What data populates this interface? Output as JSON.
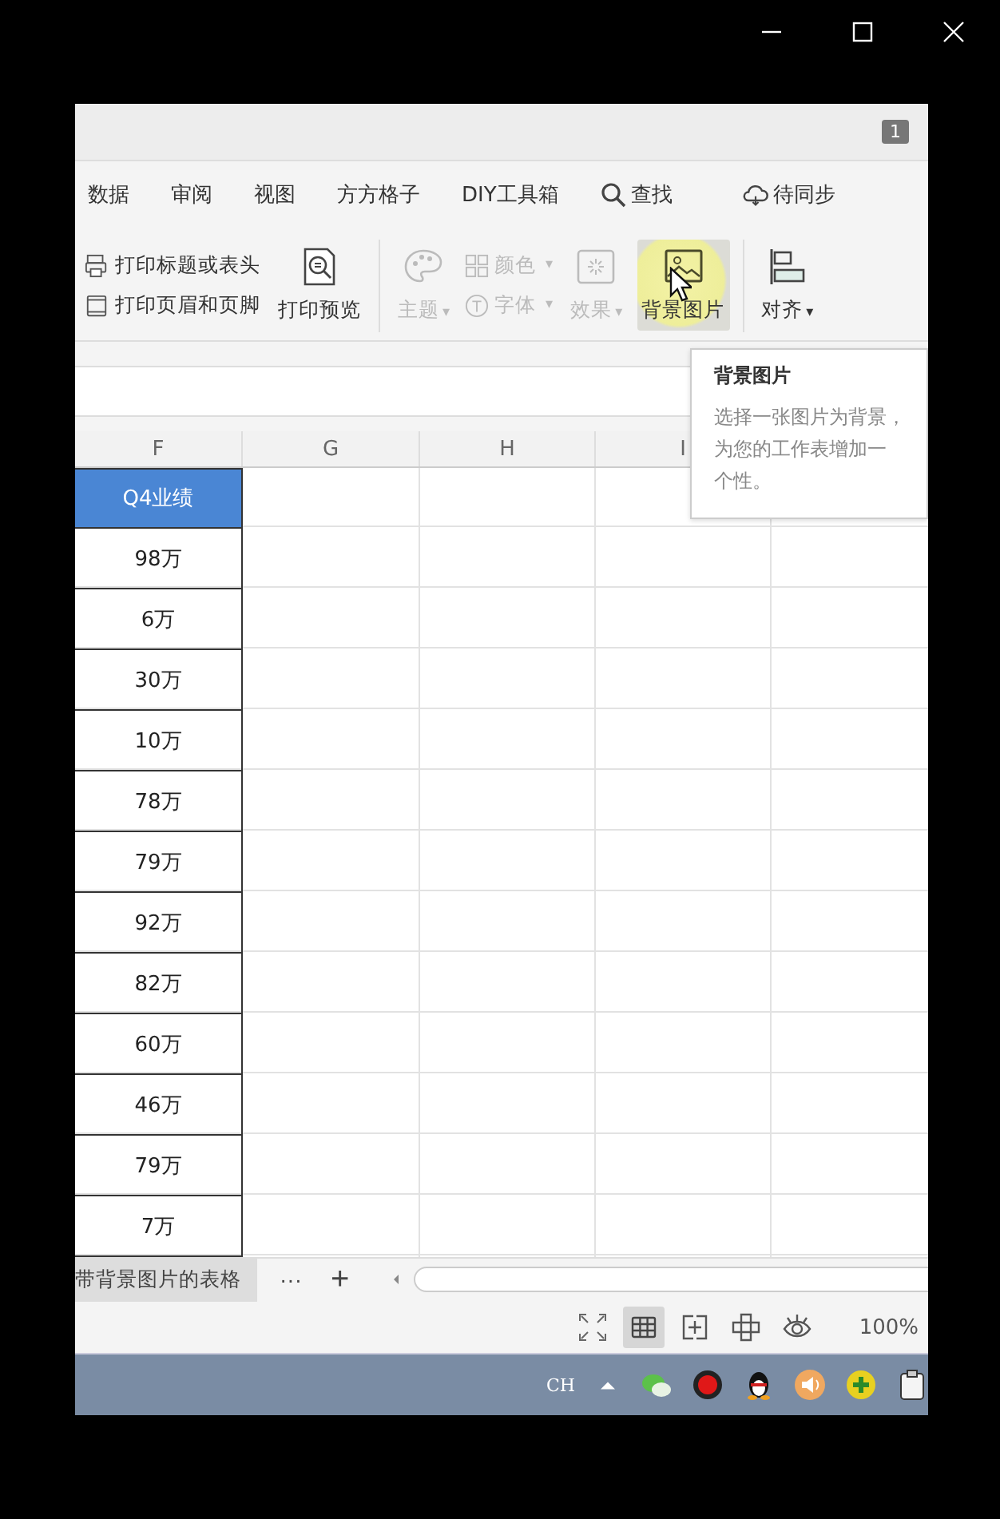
{
  "window_controls": [
    {
      "kind": "minimize"
    },
    {
      "kind": "maximize"
    },
    {
      "kind": "close"
    }
  ],
  "top_badge": "1",
  "menu": [
    {
      "label": "数据",
      "kind": "text"
    },
    {
      "label": "审阅",
      "kind": "text"
    },
    {
      "label": "视图",
      "kind": "text"
    },
    {
      "label": "方方格子",
      "kind": "text"
    },
    {
      "label": "DIY工具箱",
      "kind": "text"
    },
    {
      "label": "查找",
      "kind": "search"
    },
    {
      "label": "待同步",
      "kind": "sync"
    }
  ],
  "ribbon": {
    "print_small": [
      {
        "label": "打印标题或表头"
      },
      {
        "label": "打印页眉和页脚"
      }
    ],
    "print_preview": {
      "label": "打印预览"
    },
    "theme": [
      {
        "label": "主题",
        "caret": "▾",
        "kind": "palette",
        "disabled": true,
        "hover": false
      },
      {
        "kind": "stack",
        "items": [
          {
            "label": "颜色",
            "caret": "▾",
            "disabled": true
          },
          {
            "label": "字体",
            "caret": "▾",
            "disabled": true
          }
        ]
      },
      {
        "label": "效果",
        "caret": "▾",
        "kind": "effect",
        "disabled": true,
        "hover": false
      },
      {
        "label": "背景图片",
        "kind": "picture",
        "disabled": false,
        "hover": true
      }
    ],
    "align": {
      "label": "对齐",
      "caret": "▾"
    }
  },
  "tooltip": {
    "title": "背景图片",
    "lines": [
      "选择一张图片为背景，",
      "为您的工作表增加一",
      "个性。"
    ]
  },
  "columns": [
    "F",
    "G",
    "H",
    "I"
  ],
  "table": {
    "header": "Q4业绩",
    "rows": [
      "98万",
      "6万",
      "30万",
      "10万",
      "78万",
      "79万",
      "92万",
      "82万",
      "60万",
      "46万",
      "79万",
      "7万"
    ]
  },
  "sheet_tab": {
    "label": "带背景图片的表格",
    "more": "···",
    "add": "+"
  },
  "views": [
    {
      "kind": "fullscreen",
      "selected": false
    },
    {
      "kind": "grid",
      "selected": true
    },
    {
      "kind": "pagebreak",
      "selected": false
    },
    {
      "kind": "layout",
      "selected": false
    },
    {
      "kind": "eye",
      "selected": false
    }
  ],
  "zoom": "100%",
  "taskbar": {
    "lang": "CH",
    "tray": [
      {
        "kind": "chat"
      },
      {
        "kind": "record"
      },
      {
        "kind": "penguin"
      },
      {
        "kind": "speaker"
      },
      {
        "kind": "plus"
      },
      {
        "kind": "clipboard"
      }
    ]
  }
}
